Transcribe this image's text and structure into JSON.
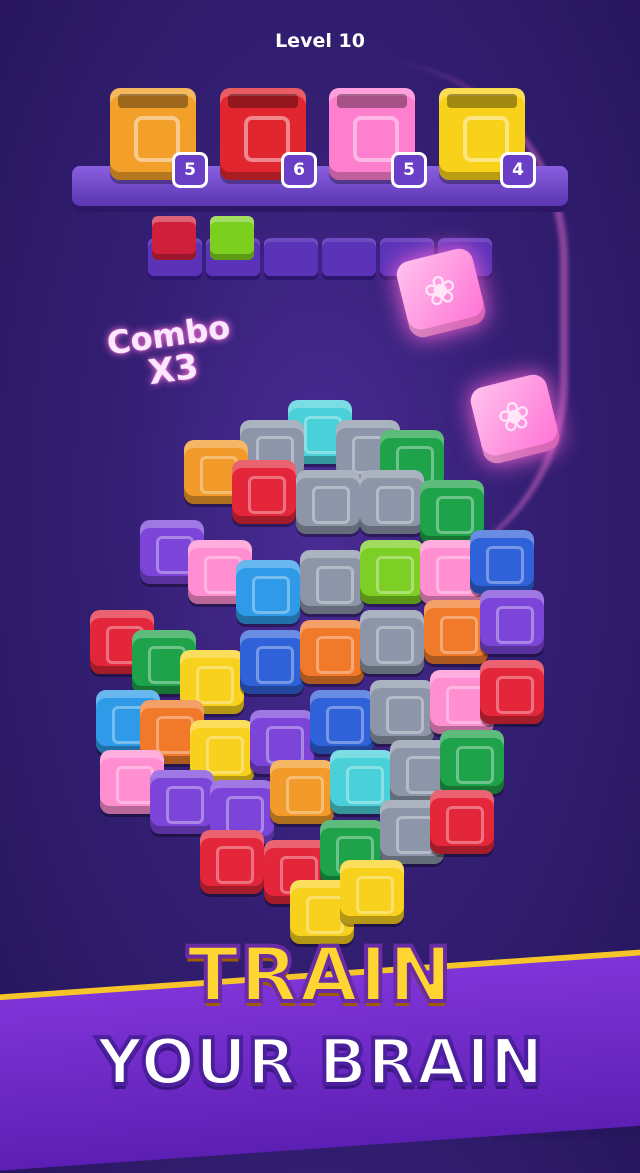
{
  "header": {
    "level_label": "Level 10"
  },
  "crates": [
    {
      "color": "#f2a02a",
      "count": "5"
    },
    {
      "color": "#e2262f",
      "count": "6"
    },
    {
      "color": "#ff7fcf",
      "count": "5"
    },
    {
      "color": "#f8d21a",
      "count": "4"
    }
  ],
  "tray": {
    "slots_total": 6,
    "tiles": [
      {
        "color": "#d01f3b"
      },
      {
        "color": "#7ccf1f"
      }
    ]
  },
  "combo": {
    "word": "Combo",
    "multiplier": "X3"
  },
  "flying_tile_color": "#ff7fd6",
  "cube_colors": [
    "#f29a2a",
    "#e3263a",
    "#8d96a8",
    "#2f9be8",
    "#7c44d8",
    "#f8d11e",
    "#1fa34a",
    "#ff8fd0",
    "#f07a2a",
    "#4ad0d8",
    "#2f62d8",
    "#7dcf25"
  ],
  "promo": {
    "line1": "TRAIN",
    "line2": "YOUR BRAIN"
  }
}
